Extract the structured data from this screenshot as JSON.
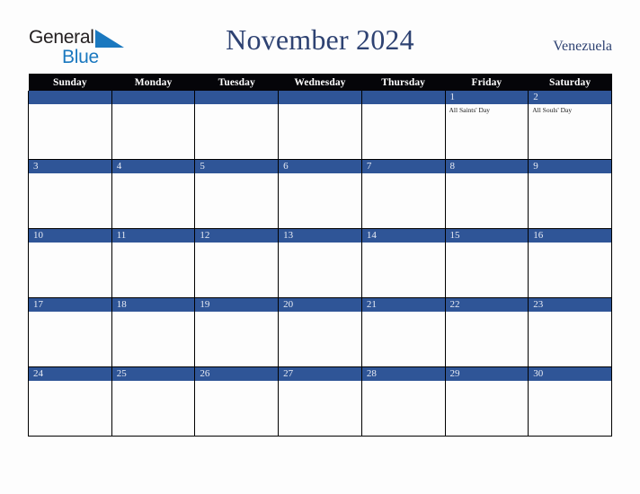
{
  "branding": {
    "logo_word1": "General",
    "logo_word2": "Blue",
    "logo_triangle_icon": "triangle-icon",
    "logo_color_dark": "#231f20",
    "logo_color_blue": "#1a78bf"
  },
  "header": {
    "title": "November 2024",
    "country": "Venezuela",
    "title_color": "#2e4272"
  },
  "calendar": {
    "header_bg": "#050509",
    "date_band_bg": "#2f5597",
    "cell_bg": "#fdfdfd",
    "weekdays": [
      "Sunday",
      "Monday",
      "Tuesday",
      "Wednesday",
      "Thursday",
      "Friday",
      "Saturday"
    ],
    "weeks": [
      [
        {
          "day": "",
          "events": []
        },
        {
          "day": "",
          "events": []
        },
        {
          "day": "",
          "events": []
        },
        {
          "day": "",
          "events": []
        },
        {
          "day": "",
          "events": []
        },
        {
          "day": "1",
          "events": [
            "All Saints' Day"
          ]
        },
        {
          "day": "2",
          "events": [
            "All Souls' Day"
          ]
        }
      ],
      [
        {
          "day": "3",
          "events": []
        },
        {
          "day": "4",
          "events": []
        },
        {
          "day": "5",
          "events": []
        },
        {
          "day": "6",
          "events": []
        },
        {
          "day": "7",
          "events": []
        },
        {
          "day": "8",
          "events": []
        },
        {
          "day": "9",
          "events": []
        }
      ],
      [
        {
          "day": "10",
          "events": []
        },
        {
          "day": "11",
          "events": []
        },
        {
          "day": "12",
          "events": []
        },
        {
          "day": "13",
          "events": []
        },
        {
          "day": "14",
          "events": []
        },
        {
          "day": "15",
          "events": []
        },
        {
          "day": "16",
          "events": []
        }
      ],
      [
        {
          "day": "17",
          "events": []
        },
        {
          "day": "18",
          "events": []
        },
        {
          "day": "19",
          "events": []
        },
        {
          "day": "20",
          "events": []
        },
        {
          "day": "21",
          "events": []
        },
        {
          "day": "22",
          "events": []
        },
        {
          "day": "23",
          "events": []
        }
      ],
      [
        {
          "day": "24",
          "events": []
        },
        {
          "day": "25",
          "events": []
        },
        {
          "day": "26",
          "events": []
        },
        {
          "day": "27",
          "events": []
        },
        {
          "day": "28",
          "events": []
        },
        {
          "day": "29",
          "events": []
        },
        {
          "day": "30",
          "events": []
        }
      ]
    ]
  }
}
